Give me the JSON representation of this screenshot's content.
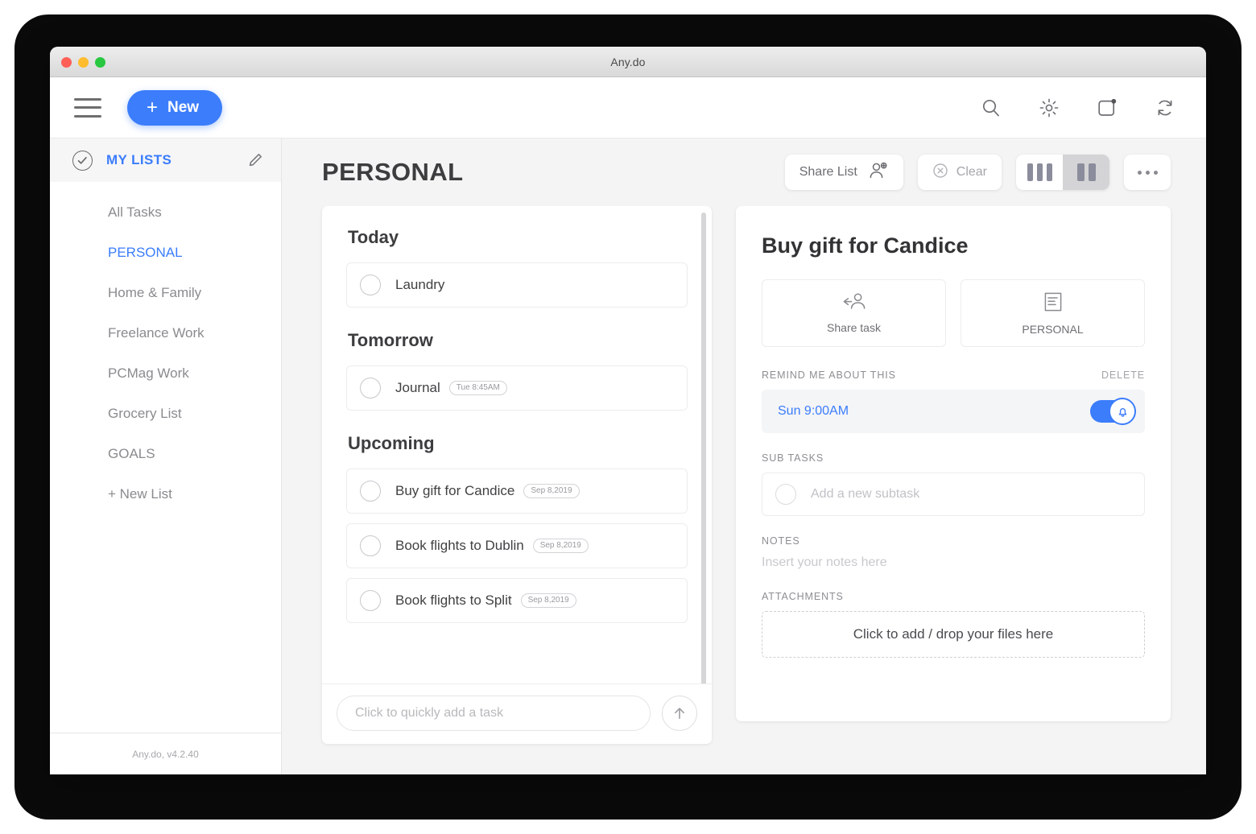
{
  "window": {
    "title": "Any.do"
  },
  "appbar": {
    "menu_icon": "hamburger-icon",
    "new_label": "New",
    "new_plus": "+",
    "icons": [
      {
        "name": "search-icon"
      },
      {
        "name": "gear-icon"
      },
      {
        "name": "notifications-icon"
      },
      {
        "name": "sync-icon"
      }
    ]
  },
  "sidebar": {
    "header_label": "MY LISTS",
    "edit_icon": "pencil-icon",
    "check_icon": "check-circle-icon",
    "items": [
      {
        "label": "All Tasks",
        "active": false
      },
      {
        "label": "PERSONAL",
        "active": true
      },
      {
        "label": "Home & Family",
        "active": false
      },
      {
        "label": "Freelance Work",
        "active": false
      },
      {
        "label": "PCMag Work",
        "active": false
      },
      {
        "label": "Grocery List",
        "active": false
      },
      {
        "label": "GOALS",
        "active": false
      },
      {
        "label": "+ New List",
        "active": false
      }
    ],
    "version": "Any.do, v4.2.40"
  },
  "main": {
    "title": "PERSONAL",
    "share_list_label": "Share List",
    "share_list_icon": "add-person-icon",
    "clear_label": "Clear",
    "clear_icon": "clear-circle-icon",
    "view_three_columns": "three-column-view",
    "view_two_columns": "two-column-view",
    "view_active": "two-column-view",
    "more_icon": "more-dots-icon"
  },
  "tasks": {
    "groups": [
      {
        "title": "Today",
        "items": [
          {
            "label": "Laundry",
            "badge": ""
          }
        ]
      },
      {
        "title": "Tomorrow",
        "items": [
          {
            "label": "Journal",
            "badge": "Tue 8:45AM"
          }
        ]
      },
      {
        "title": "Upcoming",
        "items": [
          {
            "label": "Buy gift for Candice",
            "badge": "Sep 8,2019"
          },
          {
            "label": "Book flights to Dublin",
            "badge": "Sep 8,2019"
          },
          {
            "label": "Book flights to Split",
            "badge": "Sep 8,2019"
          }
        ]
      }
    ],
    "quickadd_placeholder": "Click to quickly add a task",
    "quickadd_value": "",
    "send_icon": "arrow-up-icon"
  },
  "detail": {
    "title": "Buy gift for Candice",
    "share_task_label": "Share task",
    "share_task_icon": "share-person-icon",
    "list_label": "PERSONAL",
    "list_icon": "document-icon",
    "reminder_section": "REMIND ME ABOUT THIS",
    "delete_label": "DELETE",
    "reminder_time": "Sun 9:00AM",
    "reminder_enabled": true,
    "reminder_icon": "bell-icon",
    "subtasks_section": "SUB TASKS",
    "subtask_placeholder": "Add a new subtask",
    "notes_section": "NOTES",
    "notes_placeholder": "Insert your notes here",
    "attachments_section": "ATTACHMENTS",
    "attachments_drop_label": "Click to add / drop your files here"
  },
  "colors": {
    "accent": "#3b7dfb",
    "text_dark": "#3d3d3f",
    "text_muted": "#8b8b8f",
    "panel_bg": "#f4f4f5"
  }
}
